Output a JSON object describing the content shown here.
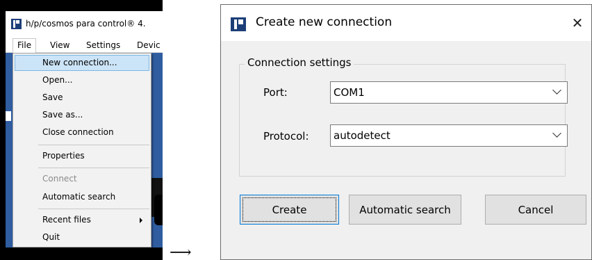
{
  "app": {
    "title": "h/p/cosmos para control® 4.",
    "menubar": [
      "File",
      "View",
      "Settings",
      "Devic"
    ]
  },
  "file_menu": {
    "items": [
      {
        "label": "New connection...",
        "state": "highlighted"
      },
      {
        "label": "Open...",
        "state": "normal"
      },
      {
        "label": "Save",
        "state": "normal"
      },
      {
        "label": "Save as...",
        "state": "normal"
      },
      {
        "label": "Close connection",
        "state": "normal"
      },
      {
        "label": "Properties",
        "state": "normal"
      },
      {
        "label": "Connect",
        "state": "disabled"
      },
      {
        "label": "Automatic search",
        "state": "normal"
      },
      {
        "label": "Recent files",
        "state": "submenu"
      },
      {
        "label": "Quit",
        "state": "normal"
      }
    ]
  },
  "arrow": "⟶",
  "dialog": {
    "title": "Create new connection",
    "close_glyph": "✕",
    "group_label": "Connection settings",
    "port": {
      "label": "Port:",
      "value": "COM1"
    },
    "protocol": {
      "label": "Protocol:",
      "value": "autodetect"
    },
    "buttons": {
      "create": "Create",
      "automatic_search": "Automatic search",
      "cancel": "Cancel"
    }
  },
  "colors": {
    "menu_highlight": "#cce4f7",
    "app_background": "#2f5da0",
    "focus_border": "#0078d7"
  }
}
